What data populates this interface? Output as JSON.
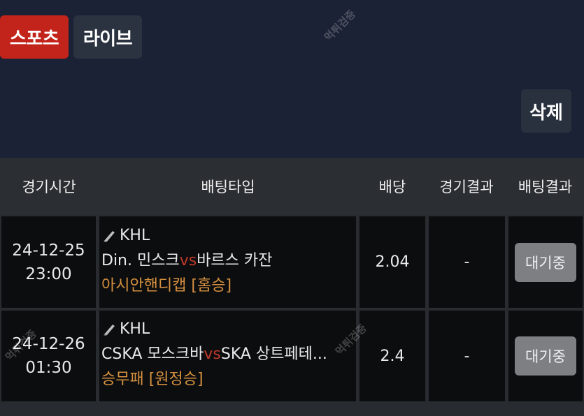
{
  "tabs": {
    "sports": "스포츠",
    "live": "라이브"
  },
  "delete_label": "삭제",
  "watermark": "먹튀검증",
  "table": {
    "headers": [
      "경기시간",
      "배팅타입",
      "배당",
      "경기결과",
      "배팅결과"
    ],
    "rows": [
      {
        "date": "24-12-25",
        "time": "23:00",
        "league": "KHL",
        "home": "Din. 민스크",
        "vs": "vs",
        "away": "바르스 카잔",
        "bet_type": "아시안핸디캡 [홈승]",
        "odds": "2.04",
        "game_result": "-",
        "bet_result": "대기중"
      },
      {
        "date": "24-12-26",
        "time": "01:30",
        "league": "KHL",
        "home": "CSKA 모스크바",
        "vs": "vs",
        "away": "SKA 상트페테...",
        "bet_type": "승무패 [원정승]",
        "odds": "2.4",
        "game_result": "-",
        "bet_result": "대기중"
      }
    ]
  }
}
